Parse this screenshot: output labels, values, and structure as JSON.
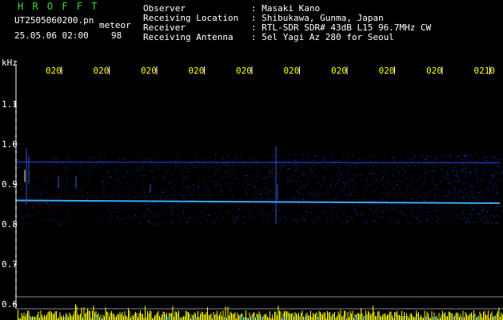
{
  "header": {
    "app_title": "H R O F F T",
    "filename": "UT2505060200.pn",
    "meteor_label": "meteor",
    "datetime": "25.05.06 02:00",
    "count": "98",
    "fields": [
      {
        "key": "Observer",
        "value": ": Masaki Kano"
      },
      {
        "key": "Receiving Location",
        "value": ": Shibukawa, Gunma, Japan"
      },
      {
        "key": "Receiver",
        "value": ": RTL-SDR SDR# 43dB L15 96.7MHz CW"
      },
      {
        "key": "Receiving Antenna",
        "value": ": 5el Yagi Az 280 for Seoul"
      }
    ]
  },
  "chart_data": {
    "type": "heatmap",
    "ylabel": "kHz",
    "y_ticks": [
      "1.1",
      "1.0",
      "0.9",
      "0.8",
      "0.7",
      "0.6"
    ],
    "x_ticks": [
      "020",
      "020",
      "020",
      "020",
      "020",
      "020",
      "020",
      "020",
      "020",
      "0210"
    ],
    "ylim": [
      0.6,
      1.1
    ],
    "carrier_khz": 0.855,
    "upper_line_khz": 0.955
  },
  "colors": {
    "background": "#000000",
    "header_text": "#ffffff",
    "title": "#33dd33",
    "time_labels": "#ffff00",
    "axis": "#ffffff",
    "signal": "#33aaff",
    "noise": "#1a2aa0",
    "activity_bar": "#ffff00"
  }
}
